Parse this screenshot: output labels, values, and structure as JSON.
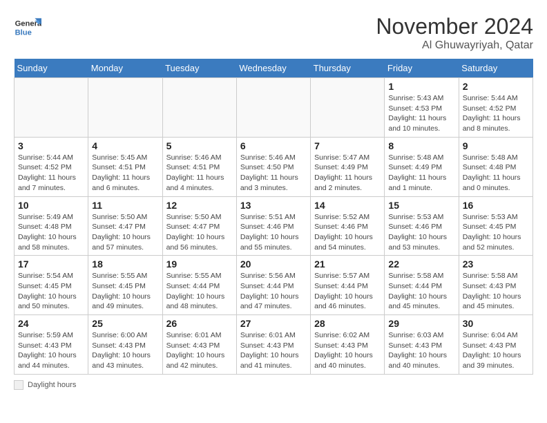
{
  "header": {
    "logo_line1": "General",
    "logo_line2": "Blue",
    "month_title": "November 2024",
    "subtitle": "Al Ghuwayriyah, Qatar"
  },
  "days_of_week": [
    "Sunday",
    "Monday",
    "Tuesday",
    "Wednesday",
    "Thursday",
    "Friday",
    "Saturday"
  ],
  "footer": {
    "label": "Daylight hours"
  },
  "weeks": [
    [
      {
        "day": "",
        "info": ""
      },
      {
        "day": "",
        "info": ""
      },
      {
        "day": "",
        "info": ""
      },
      {
        "day": "",
        "info": ""
      },
      {
        "day": "",
        "info": ""
      },
      {
        "day": "1",
        "info": "Sunrise: 5:43 AM\nSunset: 4:53 PM\nDaylight: 11 hours\nand 10 minutes."
      },
      {
        "day": "2",
        "info": "Sunrise: 5:44 AM\nSunset: 4:52 PM\nDaylight: 11 hours\nand 8 minutes."
      }
    ],
    [
      {
        "day": "3",
        "info": "Sunrise: 5:44 AM\nSunset: 4:52 PM\nDaylight: 11 hours\nand 7 minutes."
      },
      {
        "day": "4",
        "info": "Sunrise: 5:45 AM\nSunset: 4:51 PM\nDaylight: 11 hours\nand 6 minutes."
      },
      {
        "day": "5",
        "info": "Sunrise: 5:46 AM\nSunset: 4:51 PM\nDaylight: 11 hours\nand 4 minutes."
      },
      {
        "day": "6",
        "info": "Sunrise: 5:46 AM\nSunset: 4:50 PM\nDaylight: 11 hours\nand 3 minutes."
      },
      {
        "day": "7",
        "info": "Sunrise: 5:47 AM\nSunset: 4:49 PM\nDaylight: 11 hours\nand 2 minutes."
      },
      {
        "day": "8",
        "info": "Sunrise: 5:48 AM\nSunset: 4:49 PM\nDaylight: 11 hours\nand 1 minute."
      },
      {
        "day": "9",
        "info": "Sunrise: 5:48 AM\nSunset: 4:48 PM\nDaylight: 11 hours\nand 0 minutes."
      }
    ],
    [
      {
        "day": "10",
        "info": "Sunrise: 5:49 AM\nSunset: 4:48 PM\nDaylight: 10 hours\nand 58 minutes."
      },
      {
        "day": "11",
        "info": "Sunrise: 5:50 AM\nSunset: 4:47 PM\nDaylight: 10 hours\nand 57 minutes."
      },
      {
        "day": "12",
        "info": "Sunrise: 5:50 AM\nSunset: 4:47 PM\nDaylight: 10 hours\nand 56 minutes."
      },
      {
        "day": "13",
        "info": "Sunrise: 5:51 AM\nSunset: 4:46 PM\nDaylight: 10 hours\nand 55 minutes."
      },
      {
        "day": "14",
        "info": "Sunrise: 5:52 AM\nSunset: 4:46 PM\nDaylight: 10 hours\nand 54 minutes."
      },
      {
        "day": "15",
        "info": "Sunrise: 5:53 AM\nSunset: 4:46 PM\nDaylight: 10 hours\nand 53 minutes."
      },
      {
        "day": "16",
        "info": "Sunrise: 5:53 AM\nSunset: 4:45 PM\nDaylight: 10 hours\nand 52 minutes."
      }
    ],
    [
      {
        "day": "17",
        "info": "Sunrise: 5:54 AM\nSunset: 4:45 PM\nDaylight: 10 hours\nand 50 minutes."
      },
      {
        "day": "18",
        "info": "Sunrise: 5:55 AM\nSunset: 4:45 PM\nDaylight: 10 hours\nand 49 minutes."
      },
      {
        "day": "19",
        "info": "Sunrise: 5:55 AM\nSunset: 4:44 PM\nDaylight: 10 hours\nand 48 minutes."
      },
      {
        "day": "20",
        "info": "Sunrise: 5:56 AM\nSunset: 4:44 PM\nDaylight: 10 hours\nand 47 minutes."
      },
      {
        "day": "21",
        "info": "Sunrise: 5:57 AM\nSunset: 4:44 PM\nDaylight: 10 hours\nand 46 minutes."
      },
      {
        "day": "22",
        "info": "Sunrise: 5:58 AM\nSunset: 4:44 PM\nDaylight: 10 hours\nand 45 minutes."
      },
      {
        "day": "23",
        "info": "Sunrise: 5:58 AM\nSunset: 4:43 PM\nDaylight: 10 hours\nand 45 minutes."
      }
    ],
    [
      {
        "day": "24",
        "info": "Sunrise: 5:59 AM\nSunset: 4:43 PM\nDaylight: 10 hours\nand 44 minutes."
      },
      {
        "day": "25",
        "info": "Sunrise: 6:00 AM\nSunset: 4:43 PM\nDaylight: 10 hours\nand 43 minutes."
      },
      {
        "day": "26",
        "info": "Sunrise: 6:01 AM\nSunset: 4:43 PM\nDaylight: 10 hours\nand 42 minutes."
      },
      {
        "day": "27",
        "info": "Sunrise: 6:01 AM\nSunset: 4:43 PM\nDaylight: 10 hours\nand 41 minutes."
      },
      {
        "day": "28",
        "info": "Sunrise: 6:02 AM\nSunset: 4:43 PM\nDaylight: 10 hours\nand 40 minutes."
      },
      {
        "day": "29",
        "info": "Sunrise: 6:03 AM\nSunset: 4:43 PM\nDaylight: 10 hours\nand 40 minutes."
      },
      {
        "day": "30",
        "info": "Sunrise: 6:04 AM\nSunset: 4:43 PM\nDaylight: 10 hours\nand 39 minutes."
      }
    ]
  ]
}
